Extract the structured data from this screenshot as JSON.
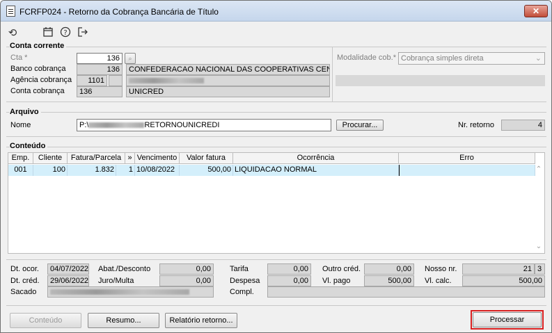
{
  "window": {
    "title": "FCRFP024 - Retorno da Cobrança Bancária de Título",
    "close_glyph": "✕"
  },
  "toolbar": {
    "icons": [
      "undo-icon",
      "calendar-icon",
      "help-icon",
      "exit-icon"
    ]
  },
  "conta_corrente": {
    "group_title": "Conta corrente",
    "cta_label": "Cta *",
    "cta_value": "136",
    "banco_label": "Banco cobrança",
    "banco_code": "136",
    "banco_name": "CONFEDERACAO NACIONAL DAS COOPERATIVAS CENTRA",
    "agencia_label": "Agência cobrança",
    "agencia_code": "1101",
    "conta_label": "Conta cobrança",
    "conta_code": "136",
    "conta_name": "UNICRED",
    "modalidade_label": "Modalidade cob.*",
    "modalidade_value": "Cobrança simples direta"
  },
  "arquivo": {
    "group_title": "Arquivo",
    "nome_label": "Nome",
    "nome_prefix": "P:\\",
    "nome_suffix": "RETORNOUNICREDI",
    "procurar_label": "Procurar...",
    "nr_retorno_label": "Nr. retorno",
    "nr_retorno_value": "4"
  },
  "conteudo": {
    "group_title": "Conteúdo",
    "columns": [
      "Emp.",
      "Cliente",
      "Fatura/Parcela",
      "»",
      "Vencimento",
      "Valor fatura",
      "Ocorrência",
      "Erro"
    ],
    "rows": [
      {
        "emp": "001",
        "cliente": "100",
        "fatura": "1.832",
        "parcela": "1",
        "vencimento": "10/08/2022",
        "valor": "500,00",
        "ocorrencia": "LIQUIDACAO NORMAL",
        "erro": ""
      }
    ]
  },
  "details": {
    "dt_ocor_label": "Dt. ocor.",
    "dt_ocor_value": "04/07/2022",
    "dt_cred_label": "Dt. créd.",
    "dt_cred_value": "29/06/2022",
    "sacado_label": "Sacado",
    "abat_label": "Abat./Desconto",
    "abat_value": "0,00",
    "juro_label": "Juro/Multa",
    "juro_value": "0,00",
    "tarifa_label": "Tarifa",
    "tarifa_value": "0,00",
    "despesa_label": "Despesa",
    "despesa_value": "0,00",
    "compl_label": "Compl.",
    "outro_label": "Outro créd.",
    "outro_value": "0,00",
    "vl_pago_label": "Vl. pago",
    "vl_pago_value": "500,00",
    "nosso_label": "Nosso nr.",
    "nosso_value": "21",
    "nosso_digit": "3",
    "vl_calc_label": "Vl. calc.",
    "vl_calc_value": "500,00"
  },
  "buttons": {
    "conteudo": "Conteúdo",
    "resumo": "Resumo...",
    "relatorio": "Relatório retorno...",
    "processar": "Processar"
  },
  "colors": {
    "highlight_border": "#d81f1f",
    "selected_row": "#d4effb"
  }
}
